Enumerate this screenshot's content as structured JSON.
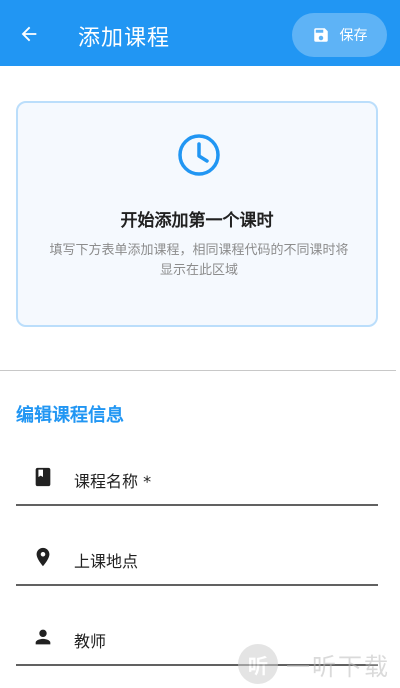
{
  "colors": {
    "primary": "#2196f3",
    "card_border": "#bbdefb",
    "card_bg": "#f5f9fe"
  },
  "appbar": {
    "title": "添加课程",
    "back_icon": "arrow-left-icon",
    "save_label": "保存",
    "save_icon": "floppy-disk-icon"
  },
  "empty_state": {
    "icon": "clock-icon",
    "title": "开始添加第一个课时",
    "description": "填写下方表单添加课程，相同课程代码的不同课时将显示在此区域"
  },
  "form": {
    "section_title": "编辑课程信息",
    "fields": [
      {
        "label": "课程名称 *",
        "icon": "book-icon"
      },
      {
        "label": "上课地点",
        "icon": "location-pin-icon"
      },
      {
        "label": "教师",
        "icon": "person-icon"
      }
    ]
  },
  "watermark": {
    "logo_text": "听",
    "text": "一听下载"
  }
}
